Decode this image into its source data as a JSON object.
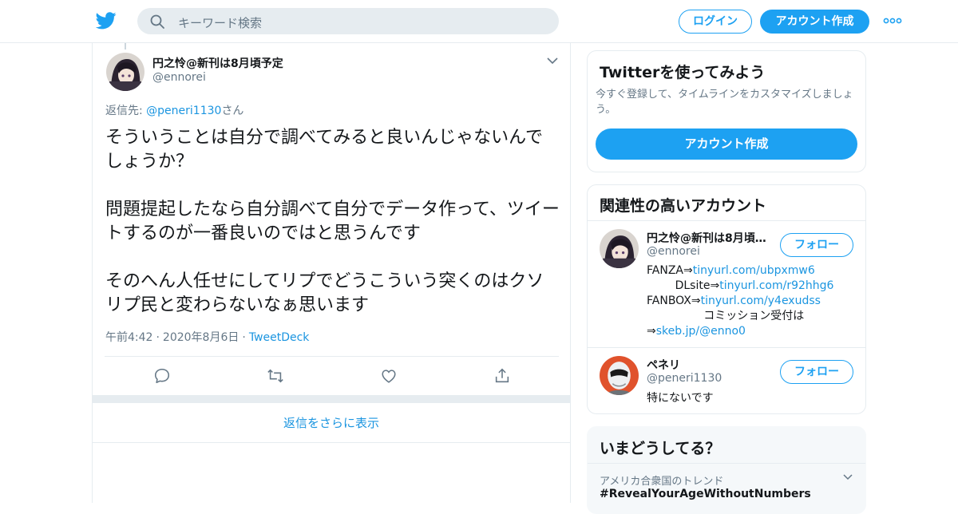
{
  "header": {
    "search_placeholder": "キーワード検索",
    "login_label": "ログイン",
    "signup_label": "アカウント作成",
    "brand_color": "#1da1f2"
  },
  "tweet": {
    "author_name": "円之怜@新刊は8月頃予定",
    "author_handle": "@ennorei",
    "reply_to_prefix": "返信先: ",
    "reply_to_handle": "@peneri1130",
    "reply_to_suffix": "さん",
    "text": "そういうことは自分で調べてみると良いんじゃないんでしょうか？\n\n問題提起したなら自分調べて自分でデータ作って、ツイートするのが一番良いのではと思うんです\n\nそのへん人任せにしてリプでどうこういう突くのはクソリプ民と変わらないなぁ思います",
    "time": "午前4:42",
    "date": "2020年8月6日",
    "source": "TweetDeck",
    "actions": [
      "reply-icon",
      "retweet-icon",
      "like-icon",
      "share-icon"
    ]
  },
  "more_replies_label": "返信をさらに表示",
  "signup_card": {
    "title": "Twitterを使ってみよう",
    "description": "今すぐ登録して、タイムラインをカスタマイズしましょう。",
    "cta_label": "アカウント作成"
  },
  "related": {
    "title": "関連性の高いアカウント",
    "accounts": [
      {
        "name": "円之怜@新刊は8月頃予定",
        "handle": "@ennorei",
        "follow_label": "フォロー",
        "bio": [
          {
            "prefix": "FANZA⇒",
            "link": "tinyurl.com/ubpxmw6"
          },
          {
            "prefix": "        DLsite⇒",
            "link": "tinyurl.com/r92hhg6"
          },
          {
            "prefix": "FANBOX⇒",
            "link": "tinyurl.com/y4exudss"
          },
          {
            "prefix": "                コミッション受付は",
            "link": ""
          },
          {
            "prefix": "⇒",
            "link": "skeb.jp/@enno0"
          }
        ]
      },
      {
        "name": "ペネリ",
        "handle": "@peneri1130",
        "follow_label": "フォロー",
        "bio_text": "特にないです"
      }
    ]
  },
  "trends": {
    "title": "いまどうしてる？",
    "context": "アメリカ合衆国のトレンド",
    "first_trend": "#RevealYourAgeWithoutNumbers"
  }
}
